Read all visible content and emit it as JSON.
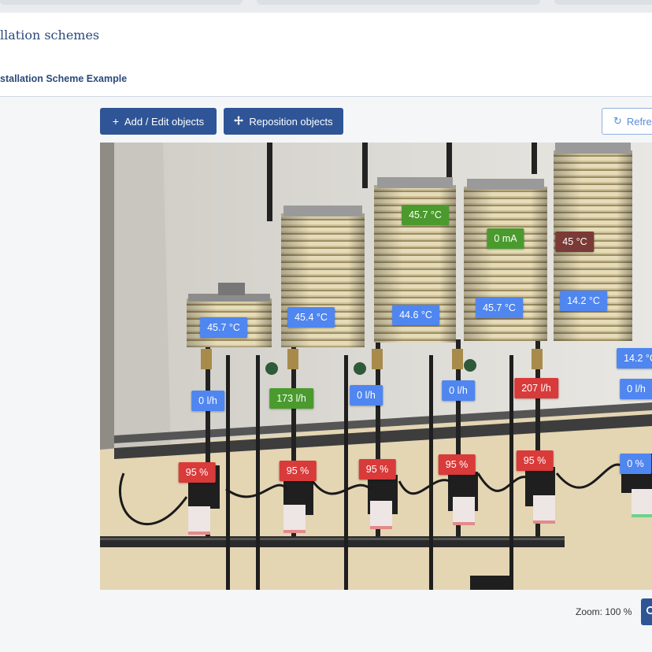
{
  "header": {
    "title": "llation schemes",
    "subtitle": "stallation Scheme Example"
  },
  "toolbar": {
    "add_edit_label": "Add / Edit objects",
    "reposition_label": "Reposition objects",
    "refresh_label": "Refre"
  },
  "scheme": {
    "tags": [
      {
        "id": "t1",
        "text": "45.7 °C",
        "status": "normal"
      },
      {
        "id": "t2",
        "text": "45.4 °C",
        "status": "normal"
      },
      {
        "id": "t3",
        "text": "45.7 °C",
        "status": "ok"
      },
      {
        "id": "t4",
        "text": "44.6 °C",
        "status": "normal"
      },
      {
        "id": "t5",
        "text": "0 mA",
        "status": "ok"
      },
      {
        "id": "t6",
        "text": "45.7 °C",
        "status": "normal"
      },
      {
        "id": "t7",
        "text": "45 °C",
        "status": "warn"
      },
      {
        "id": "t8",
        "text": "14.2 °C",
        "status": "normal"
      },
      {
        "id": "t9",
        "text": "14.2 °C",
        "status": "normal"
      },
      {
        "id": "t10",
        "text": "0 l/h",
        "status": "normal"
      },
      {
        "id": "t11",
        "text": "173 l/h",
        "status": "ok"
      },
      {
        "id": "t12",
        "text": "0 l/h",
        "status": "normal"
      },
      {
        "id": "t13",
        "text": "0 l/h",
        "status": "normal"
      },
      {
        "id": "t14",
        "text": "207 l/h",
        "status": "alarm"
      },
      {
        "id": "t15",
        "text": "0 l/h",
        "status": "normal"
      },
      {
        "id": "t16",
        "text": "95 %",
        "status": "alarm"
      },
      {
        "id": "t17",
        "text": "95 %",
        "status": "alarm"
      },
      {
        "id": "t18",
        "text": "95 %",
        "status": "alarm"
      },
      {
        "id": "t19",
        "text": "95 %",
        "status": "alarm"
      },
      {
        "id": "t20",
        "text": "95 %",
        "status": "alarm"
      },
      {
        "id": "t21",
        "text": "0 %",
        "status": "normal"
      }
    ]
  },
  "status_colors": {
    "normal": "#4f86f0",
    "ok": "#4a9a2e",
    "alarm": "#d93a3a",
    "warn": "#7a3a35"
  },
  "zoom": {
    "label": "Zoom:",
    "value": "100 %"
  },
  "icons": {
    "add": "plus-icon",
    "reposition": "move-arrows-icon",
    "refresh": "refresh-icon",
    "zoom": "magnifier-icon"
  }
}
